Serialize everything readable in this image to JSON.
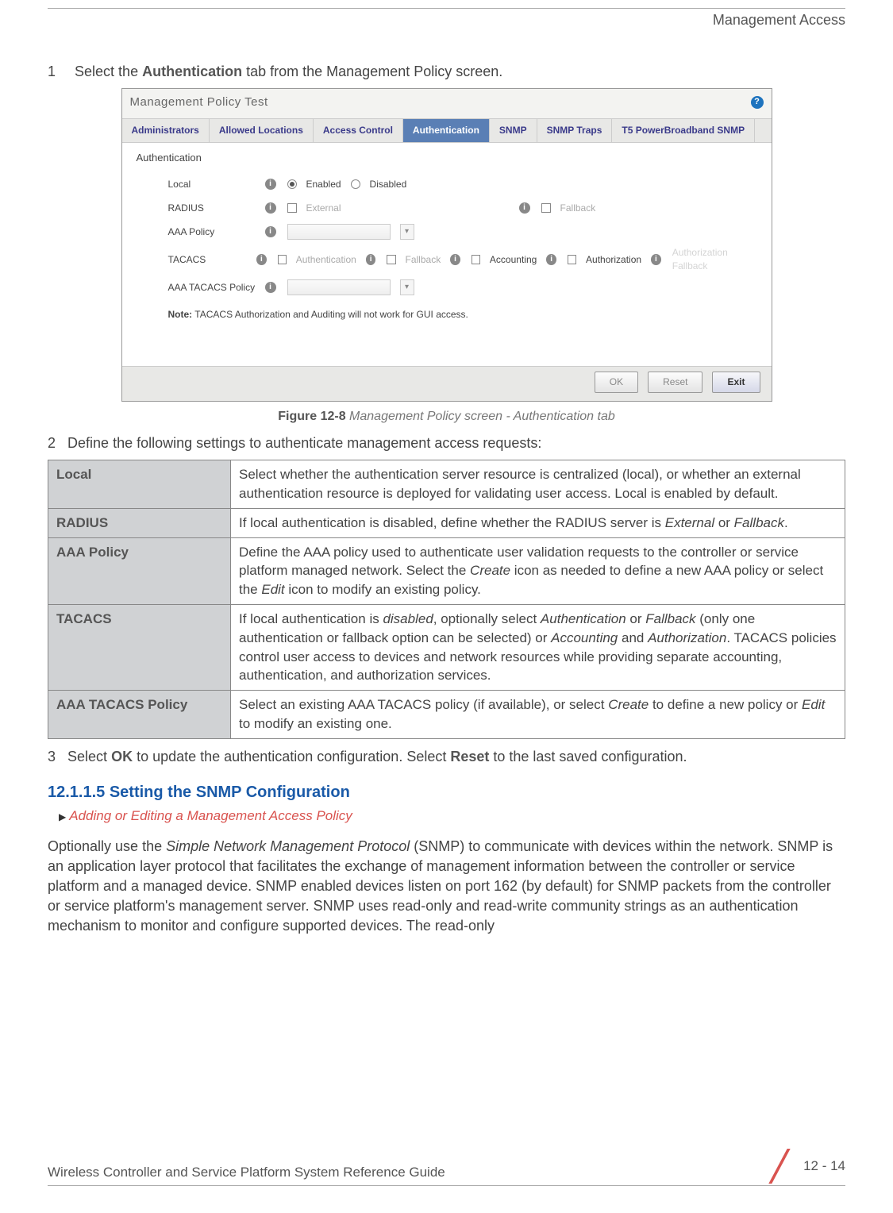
{
  "header": {
    "section": "Management Access"
  },
  "step1": {
    "num": "1",
    "pre": "Select the ",
    "bold": "Authentication",
    "post": " tab from the Management Policy screen."
  },
  "screenshot": {
    "title": "Management Policy  Test",
    "help": "?",
    "tabs": [
      "Administrators",
      "Allowed Locations",
      "Access Control",
      "Authentication",
      "SNMP",
      "SNMP Traps",
      "T5 PowerBroadband SNMP"
    ],
    "section_label": "Authentication",
    "rows": {
      "local": {
        "label": "Local",
        "enabled": "Enabled",
        "disabled": "Disabled"
      },
      "radius": {
        "label": "RADIUS",
        "external": "External",
        "fallback": "Fallback"
      },
      "aaa": {
        "label": "AAA Policy"
      },
      "tacacs": {
        "label": "TACACS",
        "auth": "Authentication",
        "fb": "Fallback",
        "acct": "Accounting",
        "authz": "Authorization",
        "afb": "Authorization Fallback"
      },
      "aaatac": {
        "label": "AAA TACACS Policy"
      }
    },
    "note_bold": "Note:",
    "note_text": " TACACS Authorization and Auditing will not work for GUI access.",
    "buttons": {
      "ok": "OK",
      "reset": "Reset",
      "exit": "Exit"
    }
  },
  "figure": {
    "num": "Figure 12-8",
    "text": "  Management Policy screen - Authentication tab"
  },
  "step2": {
    "num": "2",
    "text": "Define the following settings to authenticate management access requests:"
  },
  "table": [
    {
      "term": "Local",
      "desc": "Select whether the authentication server resource is centralized (local), or whether an external authentication resource is deployed for validating user access. Local is enabled by default."
    },
    {
      "term": "RADIUS",
      "desc_pre": "If local authentication is disabled, define whether the RADIUS server is ",
      "i1": "External",
      "mid": " or ",
      "i2": "Fallback",
      "post": "."
    },
    {
      "term": "AAA Policy",
      "desc_pre": "Define the AAA policy used to authenticate user validation requests to the controller or service platform managed network. Select the ",
      "i1": "Create",
      "mid": " icon as needed to define a new AAA policy or select the ",
      "i2": "Edit",
      "post": " icon to modify an existing policy."
    },
    {
      "term": "TACACS",
      "desc_pre": "If local authentication is ",
      "i1": "disabled",
      "m1": ", optionally select ",
      "i2": "Authentication",
      "m2": " or ",
      "i3": "Fallback",
      "m3": " (only one authentication or fallback option can be selected) or ",
      "i4": "Accounting",
      "m4": " and ",
      "i5": "Authorization",
      "post": ". TACACS policies control user access to devices and network resources while providing separate accounting, authentication, and authorization services."
    },
    {
      "term": "AAA TACACS Policy",
      "desc_pre": "Select an existing AAA TACACS policy (if available), or select ",
      "i1": "Create",
      "mid": " to define a new policy or ",
      "i2": "Edit",
      "post": " to modify an existing one."
    }
  ],
  "step3": {
    "num": "3",
    "pre": "Select ",
    "b1": "OK",
    "mid": " to update the authentication configuration. Select ",
    "b2": "Reset",
    "post": " to the last saved configuration."
  },
  "heading": "12.1.1.5  Setting the SNMP Configuration",
  "breadcrumb": "Adding or Editing a Management Access Policy",
  "para": "Optionally use the Simple Network Management Protocol (SNMP) to communicate with devices within the network. SNMP is an application layer protocol that facilitates the exchange of management information between the controller or service platform and a managed device. SNMP enabled devices listen on port 162 (by default) for SNMP packets from the controller or service platform's management server. SNMP uses read-only and read-write community strings as an authentication mechanism to monitor and configure supported devices. The read-only",
  "para_italic": "Simple Network Management Protocol",
  "footer": {
    "guide": "Wireless Controller and Service Platform System Reference Guide",
    "page": "12 - 14"
  }
}
